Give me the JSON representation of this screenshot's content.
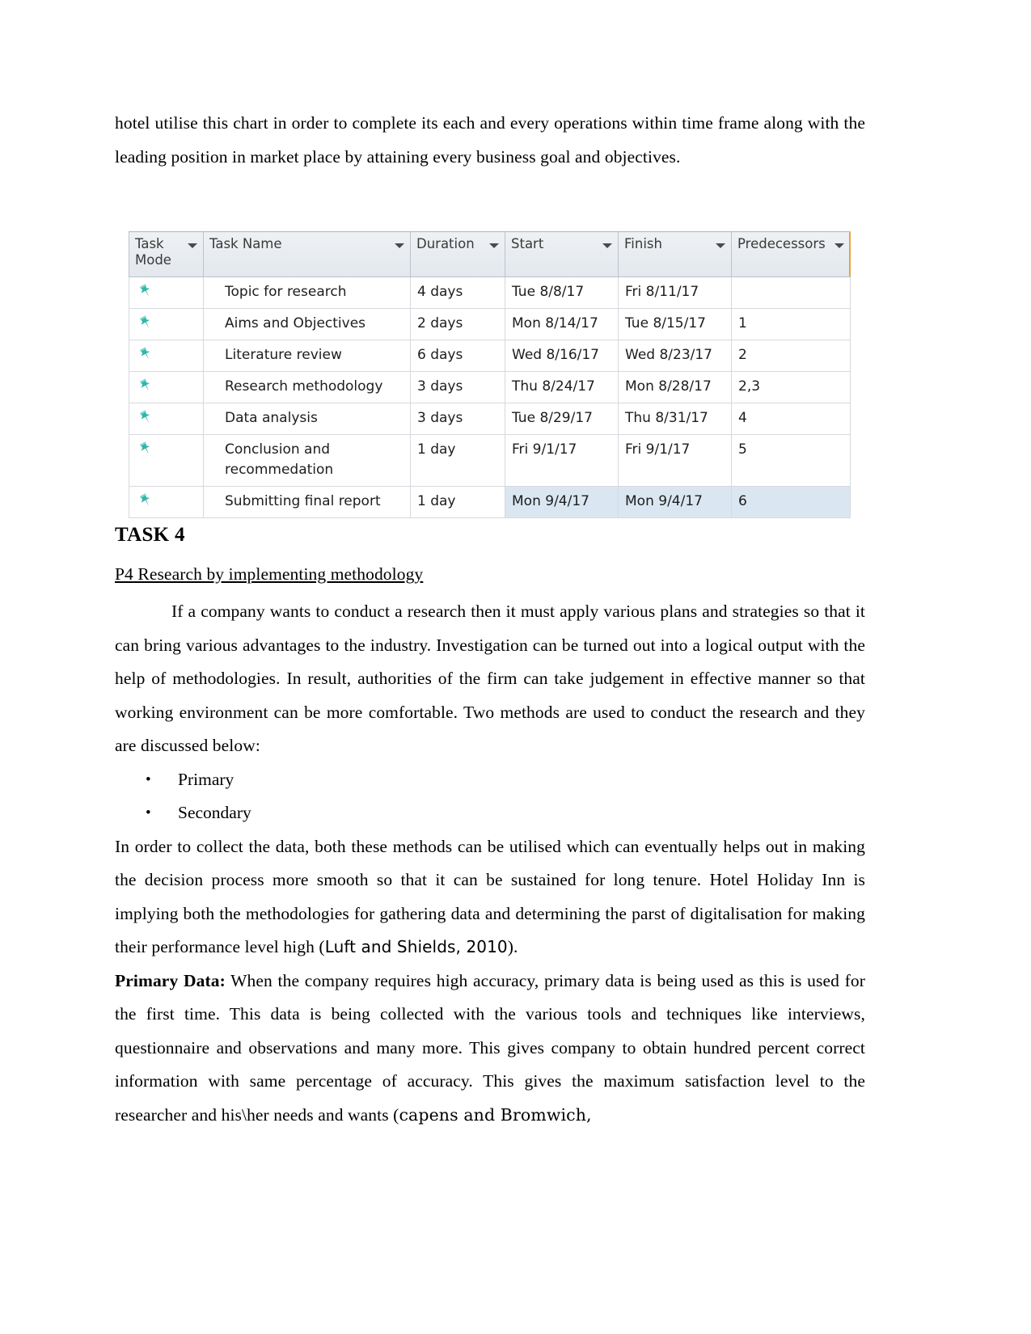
{
  "document": {
    "top_paragraph": "hotel utilise this chart in order to complete its each and every operations within time frame along with the leading position in market place by attaining every business goal and objectives.",
    "task_heading": "TASK 4",
    "sub_heading": "P4 Research by implementing methodology",
    "para_intro": "If a company wants to conduct a research then it must apply various plans and strategies so that it can bring various advantages to the industry. Investigation can be turned out into a logical output with the help of methodologies. In result, authorities  of the firm can take judgement in effective manner so that working environment can be more comfortable. Two methods are used to conduct the research and they are discussed below:",
    "bullets": [
      "Primary",
      "Secondary"
    ],
    "para_collect_a": "In order to collect the data, both these methods can be utilised which can eventually helps out in making the decision process more smooth so that it can be sustained for long tenure. Hotel Holiday Inn is implying both the methodologies for gathering data and determining the parst of digitalisation for making their performance level high (",
    "para_collect_cite": "Luft and Shields, 2010",
    "para_collect_b": ").",
    "primary_label": "Primary Data:",
    "para_primary_a": " When the company requires high accuracy, primary data is being used as this is used for the first time. This data is being collected with the various tools and techniques like interviews, questionnaire and observations and many more. This gives company to obtain hundred percent correct information with same percentage of accuracy. This gives the maximum satisfaction level to the researcher and his\\her needs and wants (",
    "para_primary_cite": "capens and Bromwich,"
  },
  "project_table": {
    "columns": [
      {
        "label": "Task Mode",
        "has_filter": true
      },
      {
        "label": "Task Name",
        "has_filter": true
      },
      {
        "label": "Duration",
        "has_filter": true
      },
      {
        "label": "Start",
        "has_filter": true
      },
      {
        "label": "Finish",
        "has_filter": true
      },
      {
        "label": "Predecessors",
        "has_filter": true
      }
    ],
    "rows": [
      {
        "mode": "manually-scheduled-pin",
        "name": "Topic for research",
        "duration": "4 days",
        "start": "Tue 8/8/17",
        "finish": "Fri 8/11/17",
        "predecessors": "",
        "selected": false
      },
      {
        "mode": "manually-scheduled-pin",
        "name": "Aims and Objectives",
        "duration": "2 days",
        "start": "Mon 8/14/17",
        "finish": "Tue 8/15/17",
        "predecessors": "1",
        "selected": false
      },
      {
        "mode": "manually-scheduled-pin",
        "name": "Literature review",
        "duration": "6 days",
        "start": "Wed 8/16/17",
        "finish": "Wed 8/23/17",
        "predecessors": "2",
        "selected": false
      },
      {
        "mode": "manually-scheduled-pin",
        "name": "Research methodology",
        "duration": "3 days",
        "start": "Thu 8/24/17",
        "finish": "Mon 8/28/17",
        "predecessors": "2,3",
        "selected": false
      },
      {
        "mode": "manually-scheduled-pin",
        "name": "Data analysis",
        "duration": "3 days",
        "start": "Tue 8/29/17",
        "finish": "Thu 8/31/17",
        "predecessors": "4",
        "selected": false
      },
      {
        "mode": "manually-scheduled-pin",
        "name": "Conclusion and recommedation",
        "duration": "1 day",
        "start": "Fri 9/1/17",
        "finish": "Fri 9/1/17",
        "predecessors": "5",
        "selected": false
      },
      {
        "mode": "manually-scheduled-pin",
        "name": "Submitting final report",
        "duration": "1 day",
        "start": "Mon 9/4/17",
        "finish": "Mon 9/4/17",
        "predecessors": "6",
        "selected": true
      }
    ],
    "colors": {
      "header_bg": "#e6ebf0",
      "grid": "#d6d9dd",
      "pin_teal": "#2eb5a8",
      "selection": "#dae7f2",
      "header_accent": "#e8a33d"
    }
  }
}
